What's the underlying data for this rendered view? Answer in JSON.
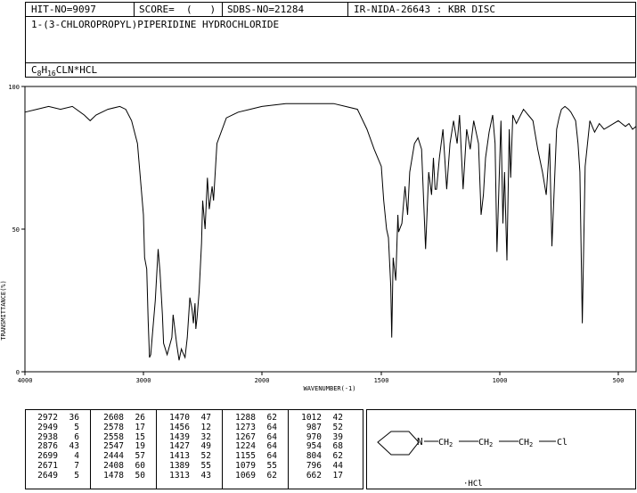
{
  "header": {
    "hit_no": "HIT-NO=9097",
    "score": "SCORE=  (   )",
    "sdbs_no": "SDBS-NO=21284",
    "ir_id": "IR-NIDA-26643 : KBR DISC",
    "compound_name": "1-(3-CHLOROPROPYL)PIPERIDINE HYDROCHLORIDE",
    "formula": "C8H16CLN*HCL"
  },
  "chart_data": {
    "type": "line",
    "xlabel": "WAVENUMBER(-1)",
    "ylabel": "TRANSMITTANCE(%)",
    "xlim": [
      4000,
      400
    ],
    "ylim": [
      0,
      100
    ],
    "x_ticks": [
      "4000",
      "3000",
      "2000",
      "1500",
      "1000",
      "500"
    ],
    "y_ticks": [
      "100",
      "50",
      "0"
    ],
    "series": [
      {
        "x": [
          4000,
          3900,
          3800,
          3700,
          3600,
          3500,
          3450,
          3400,
          3300,
          3200,
          3150,
          3100,
          3050,
          3000,
          2990,
          2972,
          2960,
          2949,
          2938,
          2920,
          2900,
          2876,
          2860,
          2840,
          2830,
          2800,
          2760,
          2750,
          2720,
          2699,
          2680,
          2671,
          2649,
          2630,
          2608,
          2590,
          2578,
          2565,
          2558,
          2547,
          2530,
          2510,
          2500,
          2480,
          2460,
          2444,
          2420,
          2408,
          2380,
          2300,
          2200,
          2100,
          2000,
          1900,
          1800,
          1700,
          1650,
          1600,
          1560,
          1530,
          1500,
          1490,
          1478,
          1470,
          1460,
          1456,
          1450,
          1439,
          1430,
          1427,
          1413,
          1400,
          1389,
          1380,
          1360,
          1345,
          1330,
          1313,
          1300,
          1288,
          1280,
          1273,
          1267,
          1255,
          1240,
          1224,
          1210,
          1195,
          1180,
          1170,
          1155,
          1140,
          1125,
          1110,
          1090,
          1079,
          1069,
          1060,
          1045,
          1030,
          1020,
          1012,
          1000,
          995,
          987,
          980,
          970,
          960,
          954,
          945,
          930,
          900,
          880,
          860,
          840,
          820,
          804,
          790,
          780,
          760,
          750,
          740,
          725,
          710,
          700,
          680,
          670,
          662,
          652,
          640,
          620,
          600,
          580,
          560,
          540,
          520,
          500,
          480,
          460,
          440,
          420,
          400
        ],
        "values": [
          91,
          92,
          93,
          92,
          93,
          90,
          88,
          90,
          92,
          93,
          92,
          88,
          80,
          55,
          40,
          36,
          18,
          5,
          6,
          15,
          25,
          43,
          35,
          20,
          10,
          6,
          12,
          20,
          10,
          4,
          8,
          7,
          5,
          12,
          26,
          22,
          17,
          24,
          15,
          19,
          28,
          45,
          60,
          50,
          68,
          57,
          65,
          60,
          80,
          89,
          91,
          92,
          93,
          94,
          94,
          94,
          93,
          92,
          85,
          78,
          72,
          60,
          50,
          47,
          30,
          12,
          40,
          32,
          55,
          49,
          52,
          65,
          55,
          70,
          80,
          82,
          78,
          43,
          70,
          62,
          75,
          64,
          64,
          75,
          85,
          64,
          80,
          88,
          80,
          90,
          64,
          85,
          78,
          88,
          80,
          55,
          62,
          75,
          84,
          90,
          80,
          42,
          75,
          88,
          52,
          70,
          39,
          85,
          68,
          90,
          87,
          92,
          90,
          88,
          78,
          70,
          62,
          80,
          44,
          85,
          89,
          92,
          93,
          92,
          91,
          88,
          80,
          70,
          17,
          72,
          88,
          84,
          87,
          85,
          86,
          87,
          88,
          87,
          86,
          87,
          85,
          86
        ]
      }
    ],
    "grid": false
  },
  "peaks": {
    "columns": [
      [
        [
          "2972",
          "36"
        ],
        [
          "2949",
          "5"
        ],
        [
          "2938",
          "6"
        ],
        [
          "2876",
          "43"
        ],
        [
          "2699",
          "4"
        ],
        [
          "2671",
          "7"
        ],
        [
          "2649",
          "5"
        ]
      ],
      [
        [
          "2608",
          "26"
        ],
        [
          "2578",
          "17"
        ],
        [
          "2558",
          "15"
        ],
        [
          "2547",
          "19"
        ],
        [
          "2444",
          "57"
        ],
        [
          "2408",
          "60"
        ],
        [
          "1478",
          "50"
        ]
      ],
      [
        [
          "1470",
          "47"
        ],
        [
          "1456",
          "12"
        ],
        [
          "1439",
          "32"
        ],
        [
          "1427",
          "49"
        ],
        [
          "1413",
          "52"
        ],
        [
          "1389",
          "55"
        ],
        [
          "1313",
          "43"
        ]
      ],
      [
        [
          "1288",
          "62"
        ],
        [
          "1273",
          "64"
        ],
        [
          "1267",
          "64"
        ],
        [
          "1224",
          "64"
        ],
        [
          "1155",
          "64"
        ],
        [
          "1079",
          "55"
        ],
        [
          "1069",
          "62"
        ]
      ],
      [
        [
          "1012",
          "42"
        ],
        [
          "987",
          "52"
        ],
        [
          "970",
          "39"
        ],
        [
          "954",
          "68"
        ],
        [
          "804",
          "62"
        ],
        [
          "796",
          "44"
        ],
        [
          "662",
          "17"
        ]
      ]
    ]
  },
  "structure": {
    "n_label": "N",
    "ch2_1": "CH2",
    "ch2_2": "CH2",
    "ch2_3": "CH2",
    "cl": "Cl",
    "salt": "·HCl"
  }
}
